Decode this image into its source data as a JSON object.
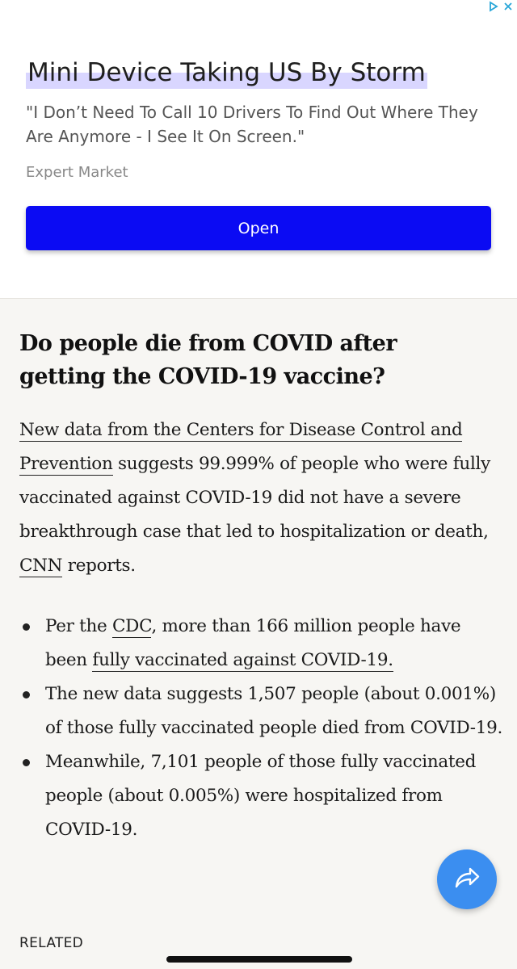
{
  "ad": {
    "headline": "Mini Device Taking US By Storm",
    "body": "\"I Don’t Need To Call 10 Drivers To Find Out Where They Are Anymore - I See It On Screen.\"",
    "source": "Expert Market",
    "button_label": "Open",
    "accent_color": "#0b0bf3",
    "choices_icons": [
      "adchoices-icon",
      "close-icon"
    ]
  },
  "article": {
    "heading": "Do people die from COVID after getting the COVID-19 vaccine?",
    "para": {
      "link_cdc": "New data from the Centers for Disease Control and Prevention",
      "text_1": " suggests 99.999% of people who were fully vaccinated against COVID-19 did not have a severe breakthrough case that led to hospitalization or death, ",
      "link_cnn": "CNN",
      "text_2": " reports."
    },
    "bullets": [
      {
        "pre": "Per the ",
        "link_cdc": "CDC",
        "mid": ", more than 166 million people have been ",
        "link_vax": "fully vaccinated against COVID-19."
      },
      {
        "text": "The new data suggests 1,507 people (about 0.001%) of those fully vaccinated people died from COVID-19."
      },
      {
        "text": "Meanwhile, 7,101 people of those fully vaccinated people (about 0.005%) were hospitalized from COVID-19."
      }
    ]
  },
  "share_button": {
    "icon": "share-arrow-icon",
    "color": "#3b8ef0"
  },
  "footer": {
    "related_label": "RELATED"
  }
}
